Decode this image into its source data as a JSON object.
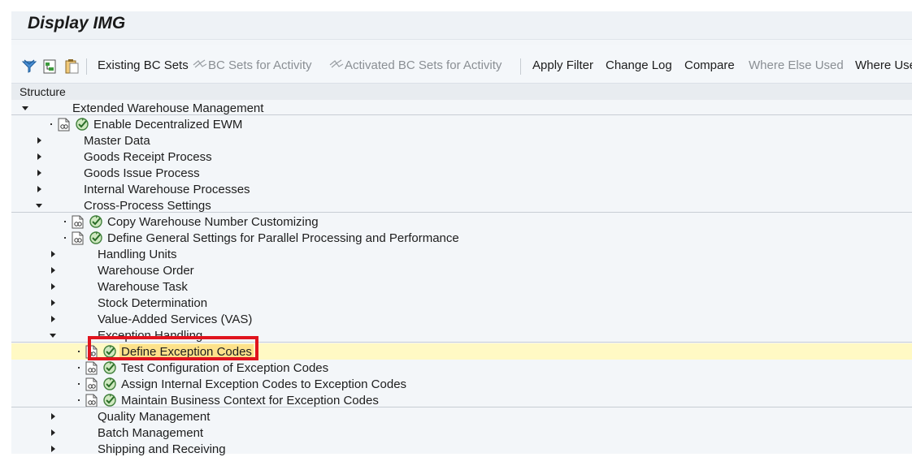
{
  "window": {
    "title": "Display IMG"
  },
  "toolbar": {
    "icons": [
      "filter-funnel-icon",
      "expand-tree-icon",
      "clipboard-icon"
    ],
    "buttons": [
      {
        "label": "Existing BC Sets",
        "enabled": true
      },
      {
        "label": "BC Sets for Activity",
        "enabled": false,
        "icon": "bc-set-icon"
      },
      {
        "label": "Activated BC Sets for Activity",
        "enabled": false,
        "icon": "bc-set-icon"
      },
      {
        "label": "Apply Filter",
        "enabled": true
      },
      {
        "label": "Change Log",
        "enabled": true
      },
      {
        "label": "Compare",
        "enabled": true
      },
      {
        "label": "Where Else Used",
        "enabled": false
      },
      {
        "label": "Where Use",
        "enabled": true
      }
    ]
  },
  "structure": {
    "header": "Structure",
    "rows": [
      {
        "label": "Extended Warehouse Management",
        "level": 0,
        "state": "expanded",
        "activity": false
      },
      {
        "label": "Enable Decentralized EWM",
        "level": 1,
        "state": "leaf",
        "activity": true
      },
      {
        "label": "Master Data",
        "level": 1,
        "state": "collapsed",
        "activity": false
      },
      {
        "label": "Goods Receipt Process",
        "level": 1,
        "state": "collapsed",
        "activity": false
      },
      {
        "label": "Goods Issue Process",
        "level": 1,
        "state": "collapsed",
        "activity": false
      },
      {
        "label": "Internal Warehouse Processes",
        "level": 1,
        "state": "collapsed",
        "activity": false
      },
      {
        "label": "Cross-Process Settings",
        "level": 1,
        "state": "expanded",
        "activity": false
      },
      {
        "label": "Copy Warehouse Number Customizing",
        "level": 2,
        "state": "leaf",
        "activity": true
      },
      {
        "label": "Define General Settings for Parallel Processing and Performance",
        "level": 2,
        "state": "leaf",
        "activity": true
      },
      {
        "label": "Handling Units",
        "level": 2,
        "state": "collapsed",
        "activity": false
      },
      {
        "label": "Warehouse Order",
        "level": 2,
        "state": "collapsed",
        "activity": false
      },
      {
        "label": "Warehouse Task",
        "level": 2,
        "state": "collapsed",
        "activity": false
      },
      {
        "label": "Stock Determination",
        "level": 2,
        "state": "collapsed",
        "activity": false
      },
      {
        "label": "Value-Added Services (VAS)",
        "level": 2,
        "state": "collapsed",
        "activity": false
      },
      {
        "label": "Exception Handling",
        "level": 2,
        "state": "expanded",
        "activity": false
      },
      {
        "label": "Define Exception Codes",
        "level": 3,
        "state": "leaf",
        "activity": true,
        "selected": true
      },
      {
        "label": "Test Configuration of Exception Codes",
        "level": 3,
        "state": "leaf",
        "activity": true
      },
      {
        "label": "Assign Internal Exception Codes to Exception Codes",
        "level": 3,
        "state": "leaf",
        "activity": true
      },
      {
        "label": "Maintain Business Context for Exception Codes",
        "level": 3,
        "state": "leaf",
        "activity": true
      },
      {
        "label": "Quality Management",
        "level": 2,
        "state": "collapsed",
        "activity": false
      },
      {
        "label": "Batch Management",
        "level": 2,
        "state": "collapsed",
        "activity": false
      },
      {
        "label": "Shipping and Receiving",
        "level": 2,
        "state": "collapsed",
        "activity": false
      }
    ]
  },
  "colors": {
    "selected_row": "#fff9c4",
    "label_highlight": "#fde28b",
    "annotation_box": "#e0141e"
  }
}
